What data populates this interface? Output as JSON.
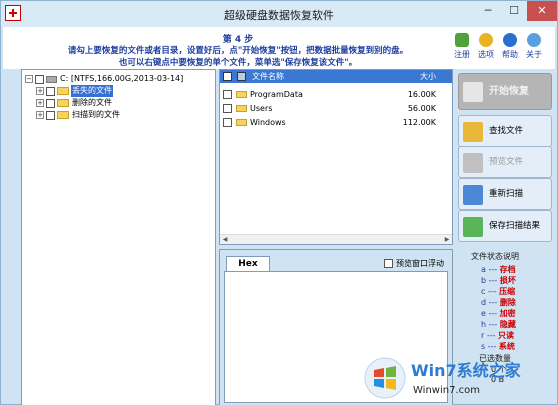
{
  "window": {
    "title": "超级硬盘数据恢复软件",
    "minimize": "─",
    "maximize": "☐",
    "close": "✕"
  },
  "instructions": {
    "step": "第 4 步",
    "line1": "请勾上要恢复的文件或者目录，设置好后，点\"开始恢复\"按钮，把数据批量恢复到别的盘。",
    "line2": "也可以右键点中要恢复的单个文件，菜单选\"保存恢复该文件\"。"
  },
  "toolbar": {
    "register": "注册",
    "options": "选项",
    "help": "帮助",
    "about": "关于"
  },
  "tree": {
    "root": "C: [NTFS,166.00G,2013-03-14]",
    "items": [
      "丢失的文件",
      "删除的文件",
      "扫描到的文件"
    ]
  },
  "file_list": {
    "col_name": "文件名称",
    "col_size": "大小",
    "rows": [
      {
        "name": "ProgramData",
        "size": "16.00K"
      },
      {
        "name": "Users",
        "size": "56.00K"
      },
      {
        "name": "Windows",
        "size": "112.00K"
      }
    ]
  },
  "preview": {
    "tab": "Hex",
    "float_option": "预览窗口浮动"
  },
  "actions": {
    "start": "开始恢复",
    "find": "查找文件",
    "preview": "预览文件",
    "rescan": "重新扫描",
    "save_scan": "保存扫描结果"
  },
  "legend": {
    "title": "文件状态说明",
    "rows": [
      {
        "code": "a",
        "label": "存档"
      },
      {
        "code": "b",
        "label": "损坏"
      },
      {
        "code": "c",
        "label": "压缩"
      },
      {
        "code": "d",
        "label": "删除"
      },
      {
        "code": "e",
        "label": "加密"
      },
      {
        "code": "h",
        "label": "隐藏"
      },
      {
        "code": "r",
        "label": "只读"
      },
      {
        "code": "s",
        "label": "系统"
      }
    ],
    "selected_label": "已选数量",
    "selected_count": "0 个",
    "selected_size": "0 B"
  },
  "watermark": {
    "text": "Win7系统之家",
    "url": "Winwin7.com"
  },
  "colors": {
    "accent_blue": "#3a78d4",
    "instruction_blue": "#1f3f9f",
    "state_code_red": "#c00000"
  }
}
